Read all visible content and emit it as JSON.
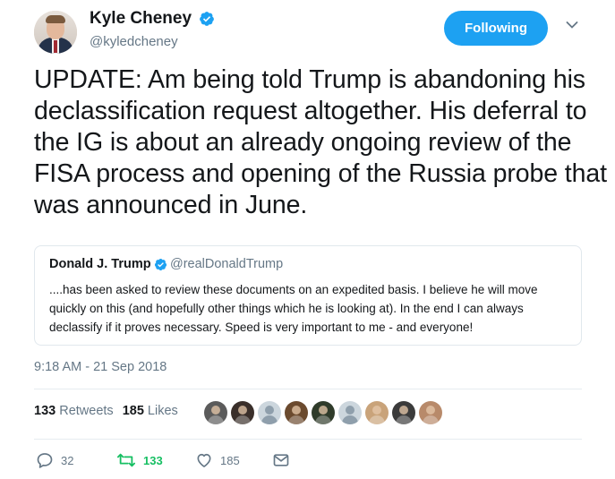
{
  "author": {
    "name": "Kyle Cheney",
    "handle": "@kyledcheney",
    "follow_label": "Following"
  },
  "tweet": {
    "text": "UPDATE: Am being told Trump is abandoning his declassification request altogether. His deferral to the IG is about an already ongoing review of the FISA process and opening of the Russia probe that was announced in June.",
    "timestamp": "9:18 AM - 21 Sep 2018"
  },
  "quoted": {
    "name": "Donald J. Trump",
    "handle": "@realDonaldTrump",
    "text": "....has been asked to review these documents on an expedited basis. I believe he will move quickly on this (and hopefully other things which he is looking at). In the end I can always declassify if it proves necessary. Speed is very important to me - and everyone!"
  },
  "stats": {
    "retweets_count": "133",
    "retweets_label": "Retweets",
    "likes_count": "185",
    "likes_label": "Likes"
  },
  "liker_avatars": [
    {
      "icon": "user-avatar",
      "color": "#5b5b5b"
    },
    {
      "icon": "user-avatar",
      "color": "#3a2f2a"
    },
    {
      "icon": "default-avatar",
      "color": "#ccd6dd"
    },
    {
      "icon": "user-avatar",
      "color": "#6b4a2e"
    },
    {
      "icon": "user-avatar",
      "color": "#2f3b2a"
    },
    {
      "icon": "default-avatar",
      "color": "#ccd6dd"
    },
    {
      "icon": "user-avatar",
      "color": "#c9a37a"
    },
    {
      "icon": "user-avatar",
      "color": "#3b3b3b"
    },
    {
      "icon": "user-avatar",
      "color": "#b88a6a"
    }
  ],
  "actions": {
    "replies": "32",
    "retweets": "133",
    "likes": "185"
  },
  "colors": {
    "accent": "#1da1f2",
    "retweet_green": "#17bf63",
    "muted": "#657786"
  }
}
